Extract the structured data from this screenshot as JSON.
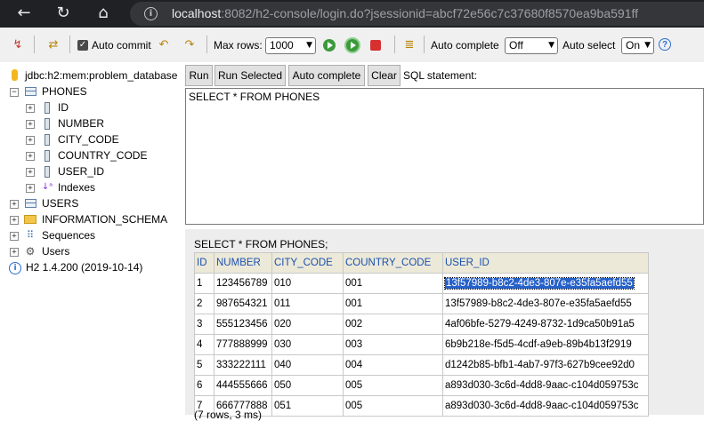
{
  "browser": {
    "url_host": "localhost",
    "url_rest": ":8082/h2-console/login.do?jsessionid=abcf72e56c7c37680f8570ea9ba591ff"
  },
  "toolbar": {
    "auto_commit_label": "Auto commit",
    "max_rows_label": "Max rows:",
    "max_rows_value": "1000",
    "auto_complete_label": "Auto complete",
    "auto_complete_value": "Off",
    "auto_select_label": "Auto select",
    "auto_select_value": "On"
  },
  "tree": {
    "database": "jdbc:h2:mem:problem_database",
    "table_phones": "PHONES",
    "columns": [
      "ID",
      "NUMBER",
      "CITY_CODE",
      "COUNTRY_CODE",
      "USER_ID"
    ],
    "indexes": "Indexes",
    "table_users": "USERS",
    "information_schema": "INFORMATION_SCHEMA",
    "sequences": "Sequences",
    "users": "Users",
    "version": "H2 1.4.200 (2019-10-14)"
  },
  "sql": {
    "run": "Run",
    "run_selected": "Run Selected",
    "auto_complete": "Auto complete",
    "clear": "Clear",
    "statement_label": "SQL statement:",
    "statement_text": "SELECT * FROM PHONES"
  },
  "results": {
    "statement": "SELECT * FROM PHONES;",
    "headers": [
      "ID",
      "NUMBER",
      "CITY_CODE",
      "COUNTRY_CODE",
      "USER_ID"
    ],
    "rows": [
      [
        "1",
        "123456789",
        "010",
        "001",
        "13f57989-b8c2-4de3-807e-e35fa5aefd55"
      ],
      [
        "2",
        "987654321",
        "011",
        "001",
        "13f57989-b8c2-4de3-807e-e35fa5aefd55"
      ],
      [
        "3",
        "555123456",
        "020",
        "002",
        "4af06bfe-5279-4249-8732-1d9ca50b91a5"
      ],
      [
        "4",
        "777888999",
        "030",
        "003",
        "6b9b218e-f5d5-4cdf-a9eb-89b4b13f2919"
      ],
      [
        "5",
        "333222111",
        "040",
        "004",
        "d1242b85-bfb1-4ab7-97f3-627b9cee92d0"
      ],
      [
        "6",
        "444555666",
        "050",
        "005",
        "a893d030-3c6d-4dd8-9aac-c104d059753c"
      ],
      [
        "7",
        "666777888",
        "051",
        "005",
        "a893d030-3c6d-4dd8-9aac-c104d059753c"
      ]
    ],
    "footer": "(7 rows, 3 ms)"
  }
}
